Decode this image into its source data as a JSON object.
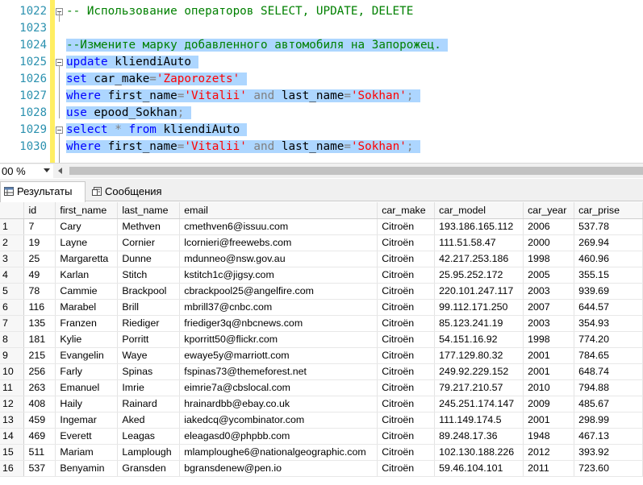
{
  "editor": {
    "lines": [
      {
        "num": "1022",
        "tokens": [
          {
            "t": "-- Использование операторов SELECT, UPDATE, DELETE",
            "c": "cm"
          }
        ]
      },
      {
        "num": "1023",
        "tokens": []
      },
      {
        "num": "1024",
        "tokens": [
          {
            "t": "--Измените марку добавленного автомобиля на Запорожец.",
            "c": "cm"
          }
        ]
      },
      {
        "num": "1025",
        "tokens": [
          {
            "t": "update",
            "c": "kw"
          },
          {
            "t": " kliendiAuto",
            "c": ""
          }
        ]
      },
      {
        "num": "1026",
        "tokens": [
          {
            "t": "set",
            "c": "kw"
          },
          {
            "t": " car_make",
            "c": ""
          },
          {
            "t": "=",
            "c": "op"
          },
          {
            "t": "'Zaporozets'",
            "c": "str"
          }
        ]
      },
      {
        "num": "1027",
        "tokens": [
          {
            "t": "where",
            "c": "kw"
          },
          {
            "t": " first_name",
            "c": ""
          },
          {
            "t": "=",
            "c": "op"
          },
          {
            "t": "'Vitalii'",
            "c": "str"
          },
          {
            "t": " and",
            "c": "op"
          },
          {
            "t": " last_name",
            "c": ""
          },
          {
            "t": "=",
            "c": "op"
          },
          {
            "t": "'Sokhan'",
            "c": "str"
          },
          {
            "t": ";",
            "c": "op"
          }
        ]
      },
      {
        "num": "1028",
        "tokens": [
          {
            "t": "use",
            "c": "kw"
          },
          {
            "t": " epood_Sokhan",
            "c": ""
          },
          {
            "t": ";",
            "c": "op"
          }
        ]
      },
      {
        "num": "1029",
        "tokens": [
          {
            "t": "select",
            "c": "kw"
          },
          {
            "t": " *",
            "c": "op"
          },
          {
            "t": " from",
            "c": "kw"
          },
          {
            "t": " kliendiAuto",
            "c": ""
          }
        ]
      },
      {
        "num": "1030",
        "tokens": [
          {
            "t": "where",
            "c": "kw"
          },
          {
            "t": " first_name",
            "c": ""
          },
          {
            "t": "=",
            "c": "op"
          },
          {
            "t": "'Vitalii'",
            "c": "str"
          },
          {
            "t": " and",
            "c": "op"
          },
          {
            "t": " last_name",
            "c": ""
          },
          {
            "t": "=",
            "c": "op"
          },
          {
            "t": "'Sokhan'",
            "c": "str"
          },
          {
            "t": ";",
            "c": "op"
          }
        ]
      }
    ]
  },
  "zoom": {
    "value": "00 %"
  },
  "tabs": {
    "results": "Результаты",
    "messages": "Сообщения"
  },
  "grid": {
    "columns": [
      "id",
      "first_name",
      "last_name",
      "email",
      "car_make",
      "car_model",
      "car_year",
      "car_prise"
    ],
    "rows": [
      [
        "1",
        "7",
        "Cary",
        "Methven",
        "cmethven6@issuu.com",
        "Citroën",
        "193.186.165.112",
        "2006",
        "537.78"
      ],
      [
        "2",
        "19",
        "Layne",
        "Cornier",
        "lcornieri@freewebs.com",
        "Citroën",
        "111.51.58.47",
        "2000",
        "269.94"
      ],
      [
        "3",
        "25",
        "Margaretta",
        "Dunne",
        "mdunneo@nsw.gov.au",
        "Citroën",
        "42.217.253.186",
        "1998",
        "460.96"
      ],
      [
        "4",
        "49",
        "Karlan",
        "Stitch",
        "kstitch1c@jigsy.com",
        "Citroën",
        "25.95.252.172",
        "2005",
        "355.15"
      ],
      [
        "5",
        "78",
        "Cammie",
        "Brackpool",
        "cbrackpool25@angelfire.com",
        "Citroën",
        "220.101.247.117",
        "2003",
        "939.69"
      ],
      [
        "6",
        "116",
        "Marabel",
        "Brill",
        "mbrill37@cnbc.com",
        "Citroën",
        "99.112.171.250",
        "2007",
        "644.57"
      ],
      [
        "7",
        "135",
        "Franzen",
        "Riediger",
        "friediger3q@nbcnews.com",
        "Citroën",
        "85.123.241.19",
        "2003",
        "354.93"
      ],
      [
        "8",
        "181",
        "Kylie",
        "Porritt",
        "kporritt50@flickr.com",
        "Citroën",
        "54.151.16.92",
        "1998",
        "774.20"
      ],
      [
        "9",
        "215",
        "Evangelin",
        "Waye",
        "ewaye5y@marriott.com",
        "Citroën",
        "177.129.80.32",
        "2001",
        "784.65"
      ],
      [
        "10",
        "256",
        "Farly",
        "Spinas",
        "fspinas73@themeforest.net",
        "Citroën",
        "249.92.229.152",
        "2001",
        "648.74"
      ],
      [
        "11",
        "263",
        "Emanuel",
        "Imrie",
        "eimrie7a@cbslocal.com",
        "Citroën",
        "79.217.210.57",
        "2010",
        "794.88"
      ],
      [
        "12",
        "408",
        "Haily",
        "Rainard",
        "hrainardbb@ebay.co.uk",
        "Citroën",
        "245.251.174.147",
        "2009",
        "485.67"
      ],
      [
        "13",
        "459",
        "Ingemar",
        "Aked",
        "iakedcq@ycombinator.com",
        "Citroën",
        "111.149.174.5",
        "2001",
        "298.99"
      ],
      [
        "14",
        "469",
        "Everett",
        "Leagas",
        "eleagasd0@phpbb.com",
        "Citroën",
        "89.248.17.36",
        "1948",
        "467.13"
      ],
      [
        "15",
        "511",
        "Mariam",
        "Lamplough",
        "mlamploughe6@nationalgeographic.com",
        "Citroën",
        "102.130.188.226",
        "2012",
        "393.92"
      ],
      [
        "16",
        "537",
        "Benyamin",
        "Gransden",
        "bgransdenew@pen.io",
        "Citroën",
        "59.46.104.101",
        "2011",
        "723.60"
      ]
    ]
  }
}
